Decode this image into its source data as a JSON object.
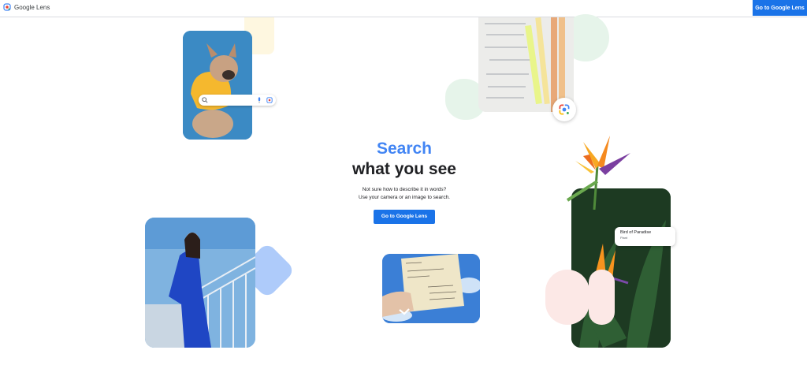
{
  "header": {
    "brand_name": "Google Lens",
    "cta_label": "Go to Google Lens"
  },
  "hero": {
    "title_line1": "Search",
    "title_line2": "what you see",
    "subtitle_line1": "Not sure how to describe it in words?",
    "subtitle_line2": "Use your camera or an image to search.",
    "cta_label": "Go to Google Lens"
  },
  "cards": {
    "plant_result": {
      "title": "Bird of Paradise",
      "subtitle": "Plant"
    }
  },
  "colors": {
    "accent_blue": "#1a73e8",
    "title_blue": "#4285f4",
    "pale_yellow": "#fef7e0",
    "pale_green": "#e6f4ea",
    "pale_pink": "#fce8e6",
    "pale_blue": "#aecbfa"
  }
}
